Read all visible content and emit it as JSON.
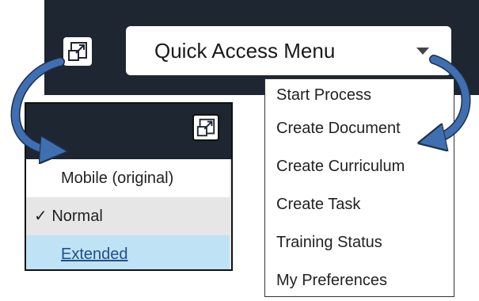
{
  "header": {
    "expand_icon": "expand-window-icon",
    "quick_access": {
      "label": "Quick Access Menu",
      "icon": "caret-down-icon"
    }
  },
  "quick_access_menu": {
    "items": [
      {
        "label": "Start Process"
      },
      {
        "label": "Create Document"
      },
      {
        "label": "Create Curriculum"
      },
      {
        "label": "Create Task"
      },
      {
        "label": "Training Status"
      },
      {
        "label": "My Preferences"
      }
    ]
  },
  "view_mode_menu": {
    "expand_icon": "expand-window-icon",
    "options": [
      {
        "label": "Mobile (original)",
        "checked": false
      },
      {
        "label": "Normal",
        "checked": true,
        "check_mark": "✓"
      },
      {
        "label": "Extended",
        "checked": false,
        "hover": true
      }
    ]
  },
  "colors": {
    "dark_bar": "#1d2631",
    "arrow": "#3f6fb0",
    "selected_row": "#e6e6e6",
    "hover_row": "#bfe3f5",
    "link": "#1f4e8c"
  }
}
